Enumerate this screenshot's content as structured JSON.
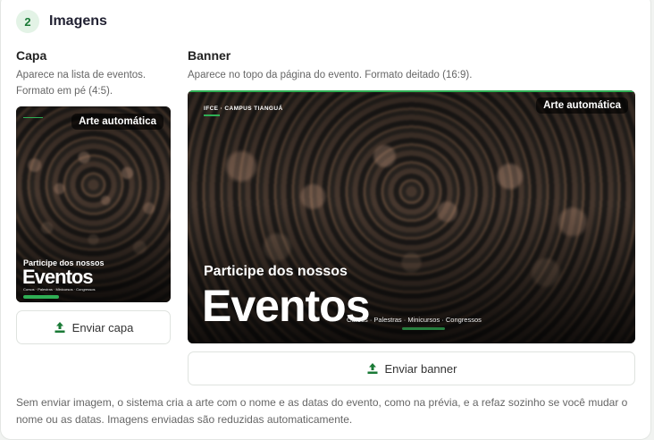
{
  "section": {
    "step": "2",
    "title": "Imagens"
  },
  "cover": {
    "title": "Capa",
    "description": "Aparece na lista de eventos. Formato em pé (4:5).",
    "badge": "Arte automática",
    "art": {
      "sub": "Participe dos nossos",
      "big": "Eventos",
      "tags": "Cursos · Palestras · Minicursos · Congressos"
    },
    "button_label": "Enviar capa",
    "button_icon": "upload-icon"
  },
  "banner": {
    "title": "Banner",
    "description": "Aparece no topo da página do evento. Formato deitado (16:9).",
    "badge": "Arte automática",
    "art": {
      "brand": "IFCE · CAMPUS TIANGUÁ",
      "sub": "Participe dos nossos",
      "big": "Eventos",
      "tags": "Cursos · Palestras · Minicursos · Congressos"
    },
    "button_label": "Enviar banner",
    "button_icon": "upload-icon"
  },
  "footnote": "Sem enviar imagem, o sistema cria a arte com o nome e as datas do evento, como na prévia, e a refaz sozinho se você mudar o nome ou as datas. Imagens enviadas são reduzidas automaticamente.",
  "colors": {
    "accent": "#1a7a36",
    "badge_bg": "#e3f3e6",
    "brand_green": "#2fae54"
  }
}
